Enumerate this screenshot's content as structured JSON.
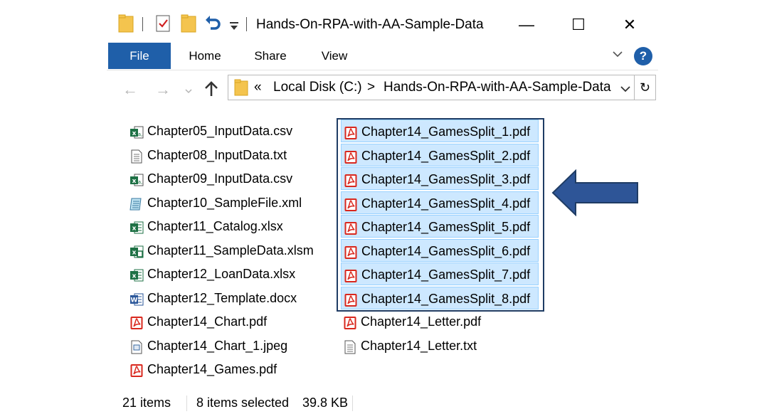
{
  "window": {
    "title": "Hands-On-RPA-with-AA-Sample-Data",
    "controls": {
      "minimize": "—",
      "maximize": "☐",
      "close": "✕"
    }
  },
  "ribbon": {
    "tabs": [
      "File",
      "Home",
      "Share",
      "View"
    ],
    "help": "?"
  },
  "address": {
    "prefix": "«",
    "segments": [
      "Local Disk (C:)",
      "Hands-On-RPA-with-AA-Sample-Data"
    ],
    "separator": ">"
  },
  "files_col1": [
    {
      "name": "Chapter05_InputData.csv",
      "icon": "excel-csv-icon"
    },
    {
      "name": "Chapter08_InputData.txt",
      "icon": "text-file-icon"
    },
    {
      "name": "Chapter09_InputData.csv",
      "icon": "excel-csv-icon"
    },
    {
      "name": "Chapter10_SampleFile.xml",
      "icon": "xml-file-icon"
    },
    {
      "name": "Chapter11_Catalog.xlsx",
      "icon": "excel-icon"
    },
    {
      "name": "Chapter11_SampleData.xlsm",
      "icon": "excel-macro-icon"
    },
    {
      "name": "Chapter12_LoanData.xlsx",
      "icon": "excel-icon"
    },
    {
      "name": "Chapter12_Template.docx",
      "icon": "word-icon"
    },
    {
      "name": "Chapter14_Chart.pdf",
      "icon": "pdf-icon"
    },
    {
      "name": "Chapter14_Chart_1.jpeg",
      "icon": "image-file-icon"
    },
    {
      "name": "Chapter14_Games.pdf",
      "icon": "pdf-icon"
    }
  ],
  "files_col2": [
    {
      "name": "Chapter14_GamesSplit_1.pdf",
      "icon": "pdf-icon",
      "selected": true
    },
    {
      "name": "Chapter14_GamesSplit_2.pdf",
      "icon": "pdf-icon",
      "selected": true
    },
    {
      "name": "Chapter14_GamesSplit_3.pdf",
      "icon": "pdf-icon",
      "selected": true
    },
    {
      "name": "Chapter14_GamesSplit_4.pdf",
      "icon": "pdf-icon",
      "selected": true
    },
    {
      "name": "Chapter14_GamesSplit_5.pdf",
      "icon": "pdf-icon",
      "selected": true
    },
    {
      "name": "Chapter14_GamesSplit_6.pdf",
      "icon": "pdf-icon",
      "selected": true
    },
    {
      "name": "Chapter14_GamesSplit_7.pdf",
      "icon": "pdf-icon",
      "selected": true
    },
    {
      "name": "Chapter14_GamesSplit_8.pdf",
      "icon": "pdf-icon",
      "selected": true
    },
    {
      "name": "Chapter14_Letter.pdf",
      "icon": "pdf-icon",
      "selected": false
    },
    {
      "name": "Chapter14_Letter.txt",
      "icon": "text-file-icon",
      "selected": false
    }
  ],
  "status": {
    "item_count": "21 items",
    "selected": "8 items selected",
    "size": "39.8 KB"
  },
  "colors": {
    "accent": "#1f5fa9",
    "selection_fill": "#cde8ff",
    "selection_border": "#99d1ff",
    "callout_arrow": "#2e5597",
    "pdf_red": "#d9281e",
    "excel_green": "#1e7145",
    "word_blue": "#2b579a"
  }
}
